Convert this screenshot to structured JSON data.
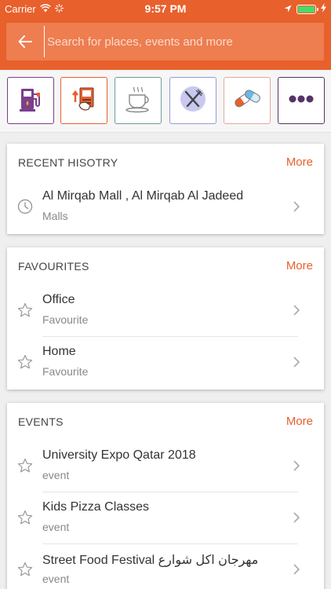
{
  "status_bar": {
    "carrier": "Carrier",
    "time": "9:57 PM"
  },
  "search": {
    "placeholder": "Search for places, events and more"
  },
  "categories": [
    {
      "icon": "fuel-pump-icon",
      "color": "#7b3f8c"
    },
    {
      "icon": "atm-icon",
      "color": "#e8602c"
    },
    {
      "icon": "coffee-icon",
      "color": "#5a8a8a"
    },
    {
      "icon": "restaurant-icon",
      "color": "#8888cc"
    },
    {
      "icon": "pharmacy-icon",
      "color": "#e89a8a"
    },
    {
      "icon": "more-icon",
      "color": "#553366"
    }
  ],
  "recent": {
    "title": "RECENT HISOTRY",
    "more": "More",
    "items": [
      {
        "title": "Al Mirqab Mall , Al Mirqab Al Jadeed",
        "subtitle": "Malls"
      }
    ]
  },
  "favourites": {
    "title": "FAVOURITES",
    "more": "More",
    "items": [
      {
        "title": "Office",
        "subtitle": "Favourite"
      },
      {
        "title": "Home",
        "subtitle": "Favourite"
      }
    ]
  },
  "events": {
    "title": "EVENTS",
    "more": "More",
    "items": [
      {
        "title": "University Expo Qatar 2018",
        "subtitle": "event"
      },
      {
        "title": "Kids Pizza Classes",
        "subtitle": "event"
      },
      {
        "title": "Street Food Festival مهرجان اكل شوارع",
        "subtitle": "event"
      }
    ]
  }
}
